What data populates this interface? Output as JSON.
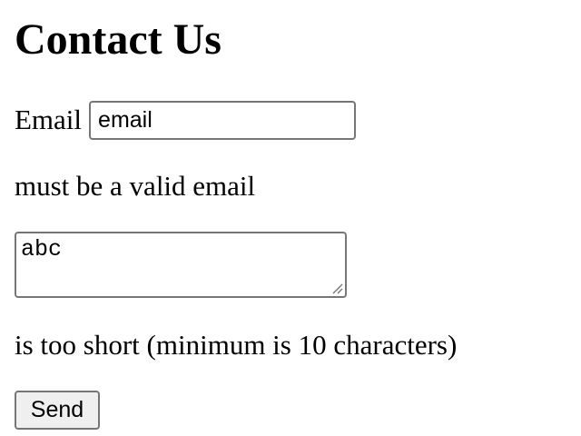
{
  "page": {
    "title": "Contact Us"
  },
  "form": {
    "email": {
      "label": "Email",
      "value": "email",
      "error": "must be a valid email"
    },
    "message": {
      "value": "abc",
      "error": "is too short (minimum is 10 characters)"
    },
    "submit_label": "Send"
  },
  "colors": {
    "field_border": "#767676",
    "button_background": "#efefef",
    "text": "#000000"
  }
}
